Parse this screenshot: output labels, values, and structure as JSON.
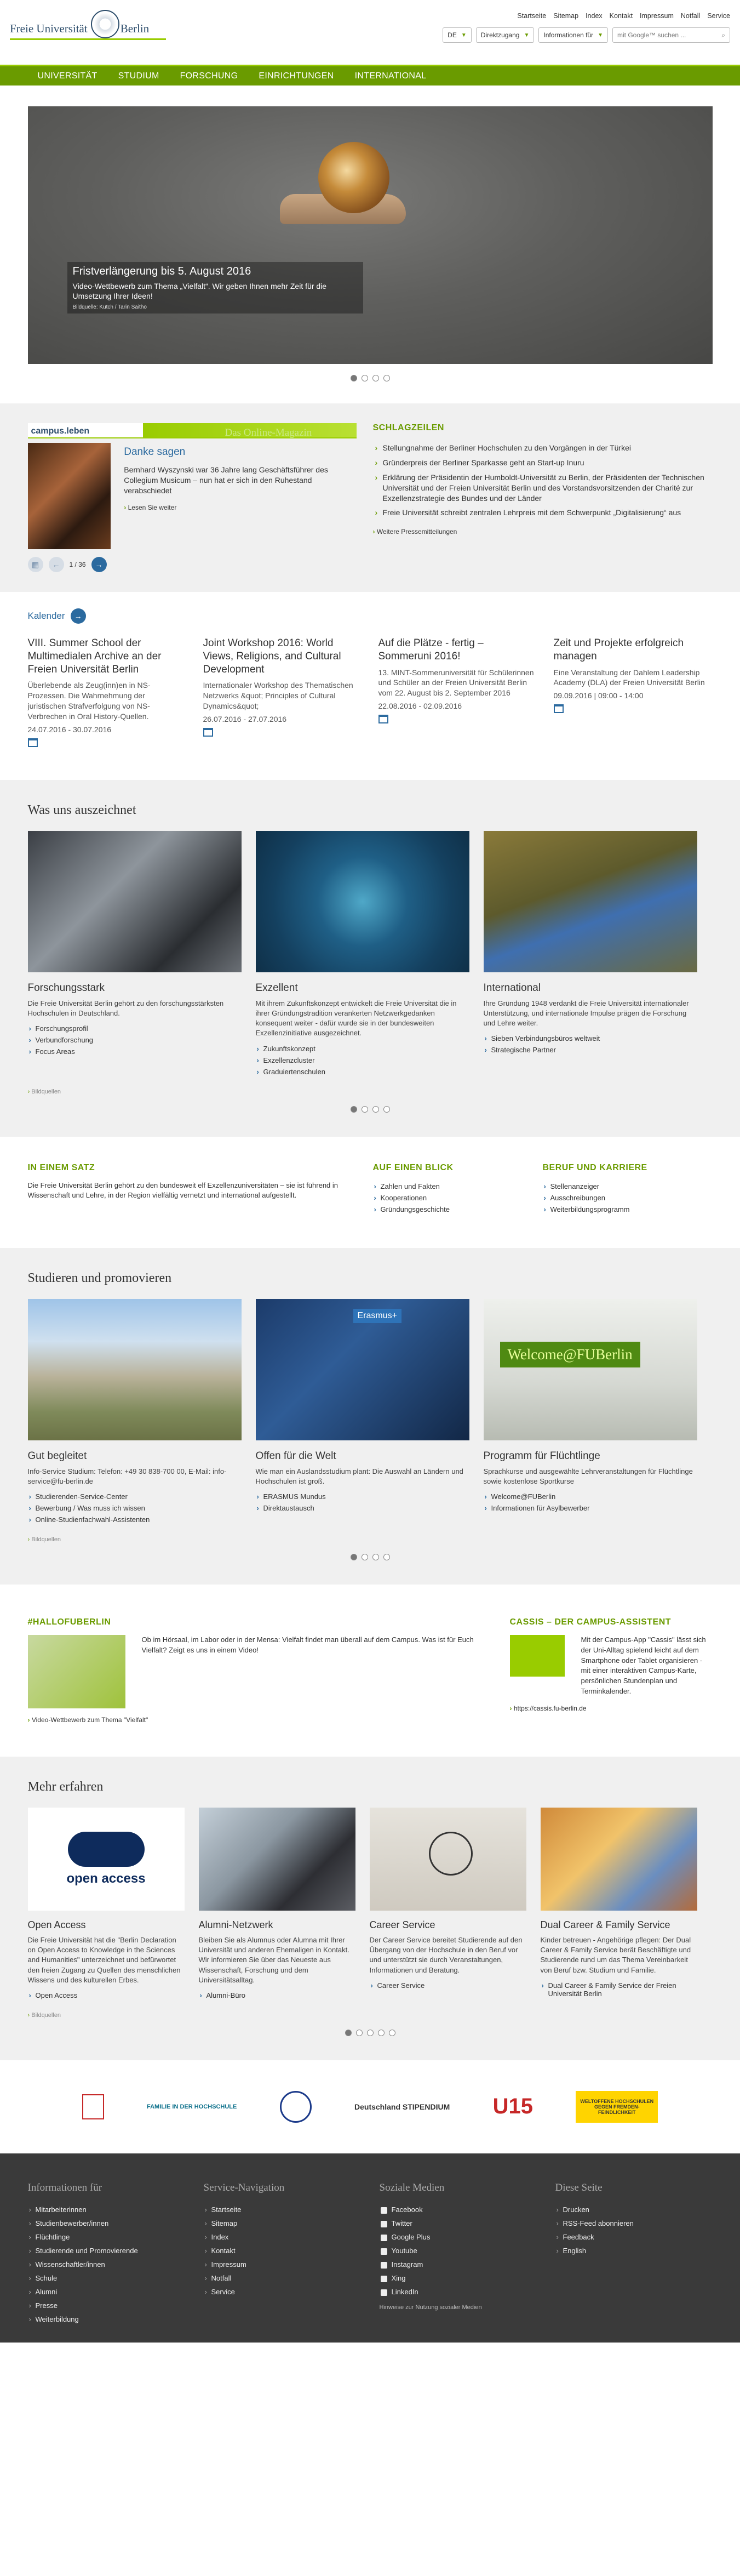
{
  "header": {
    "logo_text": "Freie Universität",
    "logo_text2": "Berlin",
    "toplinks": [
      "Startseite",
      "Sitemap",
      "Index",
      "Kontakt",
      "Impressum",
      "Notfall",
      "Service"
    ],
    "lang": "DE",
    "direkt": "Direktzugang",
    "info": "Informationen für",
    "search_placeholder": "mit Google™ suchen ..."
  },
  "nav": [
    "UNIVERSITÄT",
    "STUDIUM",
    "FORSCHUNG",
    "EINRICHTUNGEN",
    "INTERNATIONAL"
  ],
  "hero": {
    "title": "Fristverlängerung bis 5. August 2016",
    "desc": "Video-Wettbewerb zum Thema „Vielfalt“. Wir geben Ihnen mehr Zeit für die Umsetzung Ihrer Ideen!",
    "credit": "Bildquelle: Kutch / Tarin Saitho"
  },
  "campus": {
    "logo": "campus.leben",
    "overlay": "Das Online-Magazin",
    "headline": "Danke sagen",
    "text": "Bernhard Wyszynski war 36 Jahre lang Geschäftsführer des Collegium Musicum – nun hat er sich in den Ruhestand verabschiedet",
    "link": "Lesen Sie weiter",
    "page": "1 / 36"
  },
  "schlag": {
    "title": "SCHLAGZEILEN",
    "items": [
      "Stellungnahme der Berliner Hochschulen zu den Vorgängen in der Türkei",
      "Gründerpreis der Berliner Sparkasse geht an Start-up Inuru",
      "Erklärung der Präsidentin der Humboldt-Universität zu Berlin, der Präsidenten der Technischen Universität und der Freien Universität Berlin und des Vorstandsvorsitzenden der Charité zur Exzellenzstrategie des Bundes und der Länder",
      "Freie Universität schreibt zentralen Lehrpreis mit dem Schwerpunkt „Digitalisierung“ aus"
    ],
    "more": "Weitere Pressemitteilungen"
  },
  "kalender": {
    "title": "Kalender",
    "events": [
      {
        "title": "VIII. Summer School der Multimedialen Archive an der Freien Universität Berlin",
        "text": "Überlebende als Zeug(inn)en in NS-Prozessen. Die Wahrnehmung der juristischen Strafverfolgung von NS-Verbrechen in Oral History-Quellen.",
        "date": "24.07.2016 - 30.07.2016"
      },
      {
        "title": "Joint Workshop 2016: World Views, Religions, and Cultural Development",
        "text": "Internationaler Workshop des Thematischen Netzwerks &quot; Principles of Cultural Dynamics&quot;",
        "date": "26.07.2016 - 27.07.2016"
      },
      {
        "title": "Auf die Plätze - fertig – Sommeruni 2016!",
        "text": "13. MINT-Sommeruniversität für Schülerinnen und Schüler an der Freien Universität Berlin vom 22. August bis 2. September 2016",
        "date": "22.08.2016 - 02.09.2016"
      },
      {
        "title": "Zeit und Projekte erfolgreich managen",
        "text": "Eine Veranstaltung der Dahlem Leadership Academy (DLA) der Freien Universität Berlin",
        "date": "09.09.2016 | 09:00 - 14:00"
      }
    ]
  },
  "auszeichnet": {
    "title": "Was uns auszeichnet",
    "cards": [
      {
        "title": "Forschungsstark",
        "text": "Die Freie Universität Berlin gehört zu den forschungsstärksten Hochschulen in Deutschland.",
        "links": [
          "Forschungsprofil",
          "Verbundforschung",
          "Focus Areas"
        ]
      },
      {
        "title": "Exzellent",
        "text": "Mit ihrem Zukunftskonzept entwickelt die Freie Universität die in ihrer Gründungstradition verankerten Netzwerkgedanken konsequent weiter - dafür wurde sie in der bundesweiten Exzellenzinitiative ausgezeichnet.",
        "links": [
          "Zukunftskonzept",
          "Exzellenzcluster",
          "Graduiertenschulen"
        ]
      },
      {
        "title": "International",
        "text": "Ihre Gründung 1948 verdankt die Freie Universität internationaler Unterstützung, und internationale Impulse prägen die Forschung und Lehre weiter.",
        "links": [
          "Sieben Verbindungsbüros weltweit",
          "Strategische Partner"
        ]
      }
    ],
    "credits": "Bildquellen"
  },
  "satz": {
    "title": "IN EINEM SATZ",
    "text": "Die Freie Universität Berlin gehört zu den bundesweit elf Exzellenzuniversitäten – sie ist führend in Wissenschaft und Lehre, in der Region vielfältig vernetzt und international aufgestellt."
  },
  "blick": {
    "title": "AUF EINEN BLICK",
    "links": [
      "Zahlen und Fakten",
      "Kooperationen",
      "Gründungsgeschichte"
    ]
  },
  "beruf": {
    "title": "BERUF UND KARRIERE",
    "links": [
      "Stellenanzeiger",
      "Ausschreibungen",
      "Weiterbildungsprogramm"
    ]
  },
  "studieren": {
    "title": "Studieren und promovieren",
    "cards": [
      {
        "title": "Gut begleitet",
        "text": "Info-Service Studium: Telefon: +49 30 838-700 00, E-Mail: info-service@fu-berlin.de",
        "links": [
          "Studierenden-Service-Center",
          "Bewerbung / Was muss ich wissen",
          "Online-Studienfachwahl-Assistenten"
        ],
        "badge": ""
      },
      {
        "title": "Offen für die Welt",
        "text": "Wie man ein Auslandsstudium plant: Die Auswahl an Ländern und Hochschulen ist groß.",
        "links": [
          "ERASMUS Mundus",
          "Direktaustausch"
        ],
        "badge": "Erasmus+"
      },
      {
        "title": "Programm für Flüchtlinge",
        "text": "Sprachkurse und ausgewählte Lehrveranstaltungen für Flüchtlinge sowie kostenlose Sportkurse",
        "links": [
          "Welcome@FUBerlin",
          "Informationen für Asylbewerber"
        ],
        "badge": "Welcome@FUBerlin"
      }
    ],
    "credits": "Bildquellen"
  },
  "hallo": {
    "title": "#HALLOFUBERLIN",
    "text": "Ob im Hörsaal, im Labor oder in der Mensa: Vielfalt findet man überall auf dem Campus. Was ist für Euch Vielfalt? Zeigt es uns in einem Video!",
    "link": "Video-Wettbewerb zum Thema \"Vielfalt\""
  },
  "cassis": {
    "title": "CASSIS – DER CAMPUS-ASSISTENT",
    "text": "Mit der Campus-App \"Cassis\" lässt sich der Uni-Alltag spielend leicht auf dem Smartphone oder Tablet organisieren - mit einer interaktiven Campus-Karte, persönlichen Stundenplan und Terminkalender.",
    "link": "https://cassis.fu-berlin.de"
  },
  "mehr": {
    "title": "Mehr erfahren",
    "cards": [
      {
        "title": "Open Access",
        "text": "Die Freie Universität hat die \"Berlin Declaration on Open Access to Knowledge in the Sciences and Humanities\" unterzeichnet und befürwortet den freien Zugang zu Quellen des menschlichen Wissens und des kulturellen Erbes.",
        "links": [
          "Open Access"
        ],
        "logo": "open access"
      },
      {
        "title": "Alumni-Netzwerk",
        "text": "Bleiben Sie als Alumnus oder Alumna mit Ihrer Universität und anderen Ehemaligen in Kontakt. Wir informieren Sie über das Neueste aus Wissenschaft, Forschung und dem Universitätsalltag.",
        "links": [
          "Alumni-Büro"
        ],
        "logo": ""
      },
      {
        "title": "Career Service",
        "text": "Der Career Service bereitet Studierende auf den Übergang von der Hochschule in den Beruf vor und unterstützt sie durch Veranstaltungen, Informationen und Beratung.",
        "links": [
          "Career Service"
        ],
        "logo": ""
      },
      {
        "title": "Dual Career & Family Service",
        "text": "Kinder betreuen - Angehörige pflegen: Der Dual Career & Family Service berät Beschäftigte und Studierende rund um das Thema Vereinbarkeit von Beruf bzw. Studium und Familie.",
        "links": [
          "Dual Career & Family Service der Freien Universität Berlin"
        ],
        "logo": ""
      }
    ],
    "credits": "Bildquellen"
  },
  "logos": [
    "",
    "FAMILIE IN DER HOCHSCHULE",
    "",
    "Deutschland STIPENDIUM",
    "U15",
    "WELTOFFENE HOCHSCHULEN GEGEN FREMDEN-FEINDLICHKEIT"
  ],
  "footer": {
    "cols": [
      {
        "title": "Informationen für",
        "links": [
          "Mitarbeiterinnen",
          "Studienbewerber/innen",
          "Flüchtlinge",
          "Studierende und Promovierende",
          "Wissenschaftler/innen",
          "Schule",
          "Alumni",
          "Presse",
          "Weiterbildung"
        ]
      },
      {
        "title": "Service-Navigation",
        "links": [
          "Startseite",
          "Sitemap",
          "Index",
          "Kontakt",
          "Impressum",
          "Notfall",
          "Service"
        ]
      },
      {
        "title": "Soziale Medien",
        "links": [
          "Facebook",
          "Twitter",
          "Google Plus",
          "Youtube",
          "Instagram",
          "Xing",
          "LinkedIn"
        ],
        "note": "Hinweise zur Nutzung sozialer Medien"
      },
      {
        "title": "Diese Seite",
        "links": [
          "Drucken",
          "RSS-Feed abonnieren",
          "Feedback",
          "English"
        ]
      }
    ]
  }
}
